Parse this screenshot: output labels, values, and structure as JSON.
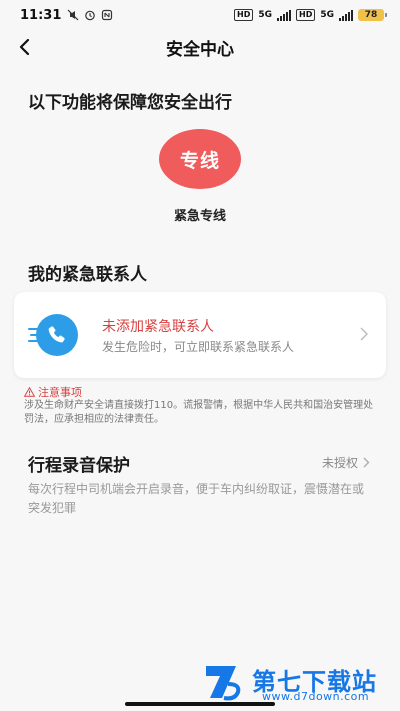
{
  "status_bar": {
    "time": "11:31",
    "net_tag_1": "HD",
    "net_type_1": "5G",
    "net_tag_2": "HD",
    "net_type_2": "5G",
    "battery": "78"
  },
  "nav": {
    "title": "安全中心"
  },
  "intro": {
    "title": "以下功能将保障您安全出行",
    "hotline_button": "专线",
    "hotline_label": "紧急专线"
  },
  "contacts": {
    "title": "我的紧急联系人",
    "card_main": "未添加紧急联系人",
    "card_sub": "发生危险时，可立即联系紧急联系人"
  },
  "notice": {
    "title": "注意事项",
    "body": "涉及生命财产安全请直接拨打110。谎报警情，根据中华人民共和国治安管理处罚法，应承担相应的法律责任。"
  },
  "recording": {
    "title": "行程录音保护",
    "status": "未授权",
    "description": "每次行程中司机端会开启录音，便于车内纠纷取证，震慑潜在或突发犯罪"
  },
  "watermark": {
    "brand": "第七下载站",
    "url": "www.d7down.com"
  },
  "colors": {
    "accent_red": "#f05b5b",
    "alert_red": "#d94141",
    "phone_blue": "#2e9de8",
    "watermark_blue": "#1677e6"
  }
}
